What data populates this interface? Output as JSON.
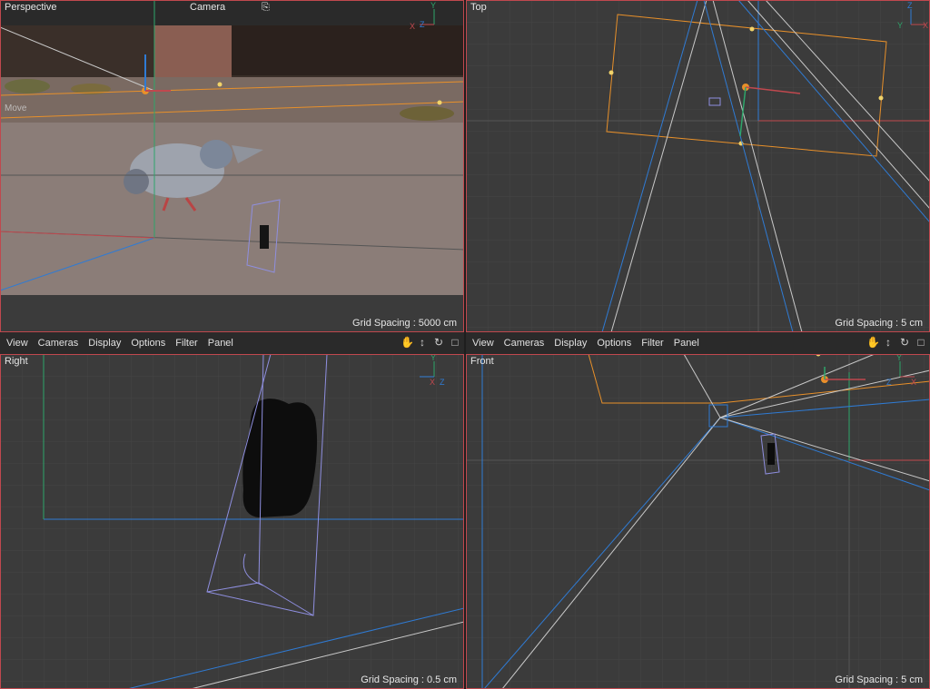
{
  "viewports": {
    "perspective": {
      "label": "Perspective",
      "camera_label": "Camera",
      "grid": "Grid Spacing : 5000 cm",
      "hud_tool": "Move"
    },
    "top": {
      "label": "Top",
      "grid": "Grid Spacing : 5 cm"
    },
    "right": {
      "label": "Right",
      "grid": "Grid Spacing : 0.5 cm"
    },
    "front": {
      "label": "Front",
      "grid": "Grid Spacing : 5 cm"
    }
  },
  "menus": {
    "left": [
      "View",
      "Cameras",
      "Display",
      "Options",
      "Filter",
      "Panel"
    ],
    "right": [
      "View",
      "Cameras",
      "Display",
      "Options",
      "Filter",
      "Panel"
    ]
  },
  "axes": {
    "x": "X",
    "y": "Y",
    "z": "Z"
  },
  "colors": {
    "border": "#c0484e",
    "grid": "#454545",
    "orange": "#e8902a",
    "blue": "#2f7bd4",
    "white": "#d8d8d8"
  }
}
